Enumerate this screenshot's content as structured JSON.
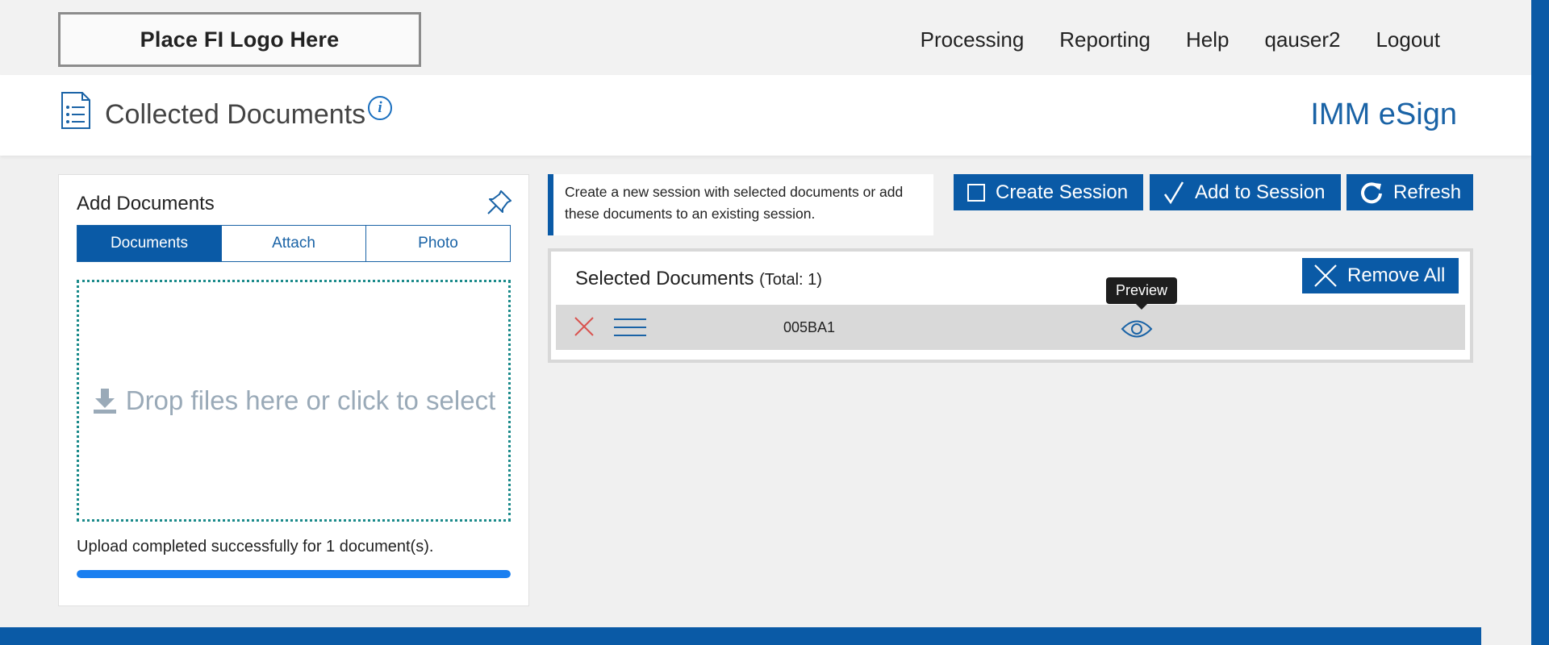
{
  "header": {
    "logo_text": "Place FI Logo Here",
    "nav": [
      "Processing",
      "Reporting",
      "Help",
      "qauser2",
      "Logout"
    ]
  },
  "titlebar": {
    "title": "Collected Documents",
    "info_glyph": "i",
    "brand": "IMM eSign"
  },
  "add_panel": {
    "title": "Add Documents",
    "tabs": [
      "Documents",
      "Attach",
      "Photo"
    ],
    "active_tab": "Documents",
    "dropzone_text": "Drop files here or click to select",
    "upload_message": "Upload completed successfully for 1 document(s).",
    "upload_progress": 1.0
  },
  "callout": {
    "text": "Create a new session with selected documents or add these documents to an existing session."
  },
  "actions": {
    "create_session": "Create Session",
    "add_to_session": "Add to Session",
    "refresh": "Refresh"
  },
  "selected": {
    "title": "Selected Documents",
    "total": "(Total: 1)",
    "remove_all": "Remove All",
    "rows": [
      {
        "name": "005BA1"
      }
    ]
  },
  "tooltip": {
    "text": "Preview"
  },
  "colors": {
    "primary": "#0a5aa6",
    "brand_text": "#1a63a6",
    "progress": "#1a7ff0",
    "delete": "#d9534f",
    "dropzone_border": "#1a8a8a"
  }
}
